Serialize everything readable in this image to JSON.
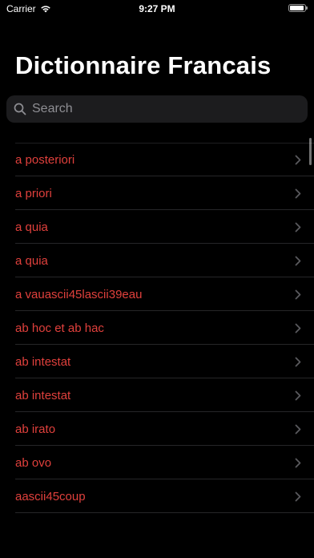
{
  "status_bar": {
    "carrier": "Carrier",
    "time": "9:27 PM"
  },
  "header": {
    "title": "Dictionnaire Francais"
  },
  "search": {
    "placeholder": "Search",
    "value": ""
  },
  "list": {
    "items": [
      {
        "label": "a posteriori"
      },
      {
        "label": "a priori"
      },
      {
        "label": "a quia"
      },
      {
        "label": "a quia"
      },
      {
        "label": "a vauascii45lascii39eau"
      },
      {
        "label": "ab hoc et ab hac"
      },
      {
        "label": "ab intestat"
      },
      {
        "label": "ab intestat"
      },
      {
        "label": "ab irato"
      },
      {
        "label": "ab ovo"
      },
      {
        "label": "aascii45coup"
      }
    ]
  },
  "colors": {
    "background": "#000000",
    "accent_text": "#e0403c",
    "search_background": "#1c1c1e",
    "placeholder": "#8e8e93",
    "chevron": "#5a5a5e"
  },
  "icons": {
    "wifi": "wifi-icon",
    "battery": "battery-icon",
    "search": "search-icon",
    "chevron": "chevron-right-icon"
  }
}
